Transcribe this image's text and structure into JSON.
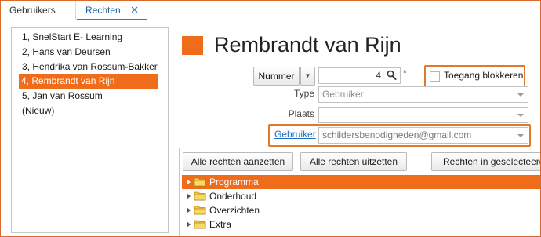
{
  "tabs": [
    {
      "label": "Gebruikers",
      "active": false
    },
    {
      "label": "Rechten",
      "active": true
    }
  ],
  "users": [
    {
      "label": "1, SnelStart E- Learning",
      "selected": false
    },
    {
      "label": "2, Hans van Deursen",
      "selected": false
    },
    {
      "label": "3, Hendrika van Rossum-Bakker",
      "selected": false
    },
    {
      "label": "4, Rembrandt van Rijn",
      "selected": true
    },
    {
      "label": "5, Jan van Rossum",
      "selected": false
    },
    {
      "label": "(Nieuw)",
      "selected": false
    }
  ],
  "header": {
    "title": "Rembrandt van Rijn"
  },
  "form": {
    "nummer_button": "Nummer",
    "nummer_value": "4",
    "required_marker": "*",
    "block_access_label": "Toegang blokkeren",
    "block_access_checked": false,
    "type_label": "Type",
    "type_value": "Gebruiker",
    "plaats_label": "Plaats",
    "plaats_value": "",
    "gebruiker_link": "Gebruiker",
    "gebruiker_value": "schildersbenodigheden@gmail.com"
  },
  "rights": {
    "buttons": {
      "all_on": "Alle rechten aanzetten",
      "all_off": "Alle rechten uitzetten",
      "selected": "Rechten in geselecteerd"
    },
    "tree": [
      {
        "label": "Programma",
        "selected": true
      },
      {
        "label": "Onderhoud",
        "selected": false
      },
      {
        "label": "Overzichten",
        "selected": false
      },
      {
        "label": "Extra",
        "selected": false
      }
    ]
  },
  "colors": {
    "accent": "#ef6c1a",
    "highlight_border": "#e0782f",
    "link": "#1f6fbf",
    "tab_active": "#2e78c7",
    "folder": "#f2c94c"
  },
  "icons": {
    "tab_close": "✕",
    "nummer_dropdown": "▼",
    "search": "search-icon",
    "folder": "folder-icon"
  }
}
